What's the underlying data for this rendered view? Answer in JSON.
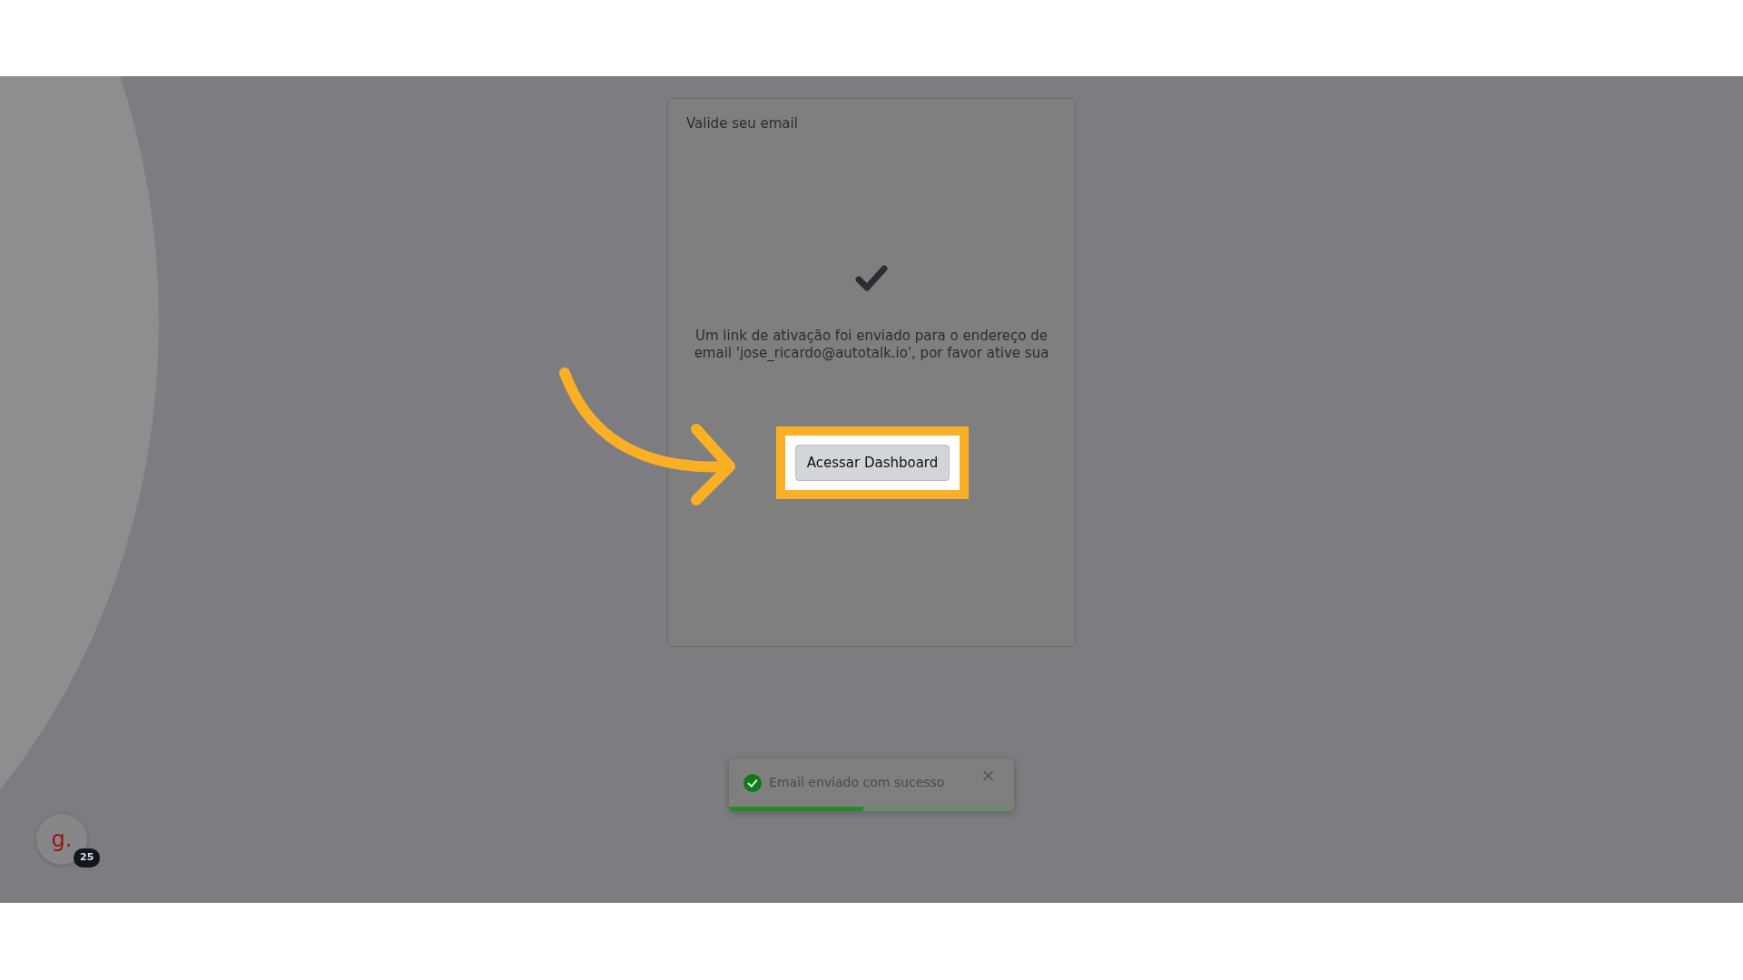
{
  "card": {
    "title": "Valide seu email",
    "message": "Um link de ativação foi enviado para o endereço de email 'jose_ricardo@autotalk.io', por favor ative sua"
  },
  "action_button": {
    "label": "Acessar Dashboard"
  },
  "toast": {
    "message": "Email enviado com sucesso",
    "close": "×",
    "level": 0.47
  },
  "avatar": {
    "letter": "g.",
    "badge": "25"
  }
}
